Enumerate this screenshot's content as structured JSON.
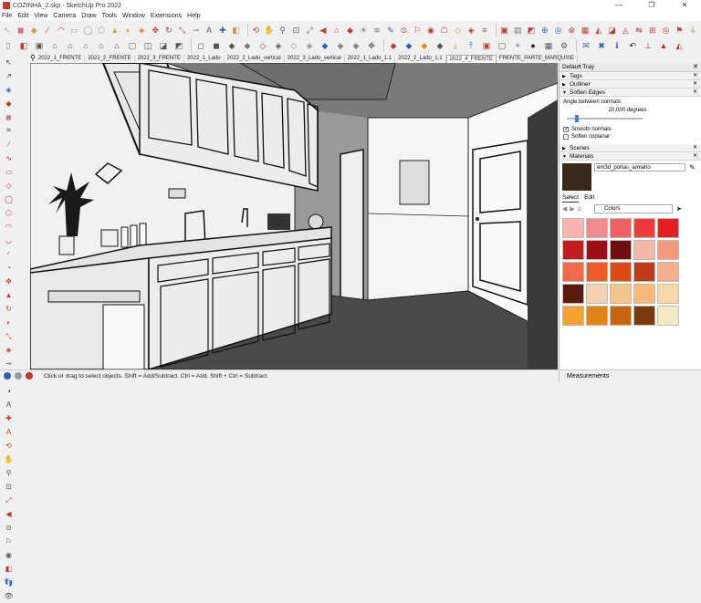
{
  "window": {
    "title": "COZINHA_2.skp - SketchUp Pro 2022",
    "buttons": [
      "—",
      "❐",
      "✕"
    ]
  },
  "menu": [
    "File",
    "Edit",
    "View",
    "Camera",
    "Draw",
    "Tools",
    "Window",
    "Extensions",
    "Help"
  ],
  "toolbar1": [
    {
      "icon": "select-icon",
      "glyph": "↖",
      "color": "#c7a45a"
    },
    {
      "icon": "eraser-icon",
      "glyph": "◼",
      "color": "#d56a8e"
    },
    {
      "icon": "paint-icon",
      "glyph": "◆",
      "color": "#d1a43a"
    },
    {
      "icon": "line-icon",
      "glyph": "∕",
      "color": "#c0392b"
    },
    {
      "icon": "arc-icon",
      "glyph": "◠",
      "color": "#c0392b"
    },
    {
      "icon": "rect-icon",
      "glyph": "▭",
      "color": "#999"
    },
    {
      "icon": "circle-icon",
      "glyph": "◯",
      "color": "#999"
    },
    {
      "icon": "polygon-icon",
      "glyph": "⬡",
      "color": "#999"
    },
    {
      "icon": "pushpull-icon",
      "glyph": "▲",
      "color": "#d1a43a"
    },
    {
      "icon": "follow-me-icon",
      "glyph": "◐",
      "color": "#d88f2a"
    },
    {
      "icon": "offset-icon",
      "glyph": "◈",
      "color": "#d18a3a"
    },
    {
      "icon": "move-icon",
      "glyph": "✥",
      "color": "#c0392b"
    },
    {
      "icon": "rotate-icon",
      "glyph": "↻",
      "color": "#c0392b"
    },
    {
      "icon": "scale-icon",
      "glyph": "⤡",
      "color": "#c0392b"
    },
    {
      "icon": "tape-icon",
      "glyph": "⊸",
      "color": "#777"
    },
    {
      "icon": "text-icon",
      "glyph": "A",
      "color": "#555"
    },
    {
      "icon": "axes-icon",
      "glyph": "✚",
      "color": "#2b5fb8"
    },
    {
      "icon": "section-icon",
      "glyph": "◧",
      "color": "#d18a3a"
    },
    {
      "icon": "orbit-icon",
      "glyph": "⟲",
      "color": "#c0392b"
    },
    {
      "icon": "pan-icon",
      "glyph": "✋",
      "color": "#777"
    },
    {
      "icon": "zoom-icon",
      "glyph": "⚲",
      "color": "#555"
    },
    {
      "icon": "zoom-window-icon",
      "glyph": "⊡",
      "color": "#555"
    },
    {
      "icon": "zoom-extents-icon",
      "glyph": "⤢",
      "color": "#555"
    },
    {
      "icon": "prev-view-icon",
      "glyph": "◀",
      "color": "#c0392b"
    },
    {
      "icon": "warehouse-icon",
      "glyph": "⌂",
      "color": "#c0392b"
    },
    {
      "icon": "extension-icon",
      "glyph": "◆",
      "color": "#c0392b"
    },
    {
      "icon": "shadows-icon",
      "glyph": "☀",
      "color": "#777"
    },
    {
      "icon": "fog-icon",
      "glyph": "≋",
      "color": "#777"
    },
    {
      "icon": "edit-icon",
      "glyph": "✎",
      "color": "#2b5fb8"
    },
    {
      "icon": "camera-icon",
      "glyph": "⊙",
      "color": "#c0392b"
    },
    {
      "icon": "walk-icon",
      "glyph": "⚐",
      "color": "#c0392b"
    },
    {
      "icon": "look-around-icon",
      "glyph": "◉",
      "color": "#c0392b"
    },
    {
      "icon": "position-camera-icon",
      "glyph": "☖",
      "color": "#c0392b"
    },
    {
      "icon": "component-icon",
      "glyph": "◇",
      "color": "#d88f2a"
    },
    {
      "icon": "material-icon",
      "glyph": "◈",
      "color": "#c0392b"
    },
    {
      "icon": "outliner-icon",
      "glyph": "≡",
      "color": "#c0392b"
    },
    {
      "icon": "scene-icon",
      "glyph": "▣",
      "color": "#c0392b"
    },
    {
      "icon": "layers-icon",
      "glyph": "▤",
      "color": "#777"
    },
    {
      "icon": "styles-icon",
      "glyph": "◩",
      "color": "#c0392b"
    },
    {
      "icon": "geo-icon",
      "glyph": "⊕",
      "color": "#2b5fb8"
    },
    {
      "icon": "add-location-icon",
      "glyph": "◎",
      "color": "#2b5fb8"
    },
    {
      "icon": "trimble-icon",
      "glyph": "⊗",
      "color": "#c0392b"
    },
    {
      "icon": "sandbox-icon",
      "glyph": "▦",
      "color": "#c0392b"
    },
    {
      "icon": "smoove-icon",
      "glyph": "◭",
      "color": "#c0392b"
    },
    {
      "icon": "stamp-icon",
      "glyph": "◪",
      "color": "#c0392b"
    },
    {
      "icon": "drape-icon",
      "glyph": "◬",
      "color": "#c0392b"
    },
    {
      "icon": "flip-icon",
      "glyph": "⇋",
      "color": "#c0392b"
    },
    {
      "icon": "scene-plus-icon",
      "glyph": "⊞",
      "color": "#c0392b"
    },
    {
      "icon": "target-icon",
      "glyph": "◎",
      "color": "#c0392b"
    },
    {
      "icon": "pin-icon",
      "glyph": "⚑",
      "color": "#c0392b"
    },
    {
      "icon": "pipe-icon",
      "glyph": "⏚",
      "color": "#d18a3a"
    }
  ],
  "toolbar2": [
    {
      "icon": "new-icon",
      "glyph": "▯",
      "color": "#777"
    },
    {
      "icon": "open-icon",
      "glyph": "◧",
      "color": "#c0392b"
    },
    {
      "icon": "save-icon",
      "glyph": "▣",
      "color": "#555"
    },
    {
      "icon": "home-icon",
      "glyph": "⌂",
      "color": "#555"
    },
    {
      "icon": "front-view-icon",
      "glyph": "⌂",
      "color": "#555"
    },
    {
      "icon": "right-view-icon",
      "glyph": "⌂",
      "color": "#555"
    },
    {
      "icon": "back-view-icon",
      "glyph": "⌂",
      "color": "#555"
    },
    {
      "icon": "left-view-icon",
      "glyph": "⌂",
      "color": "#555"
    },
    {
      "icon": "top-view-icon",
      "glyph": "▢",
      "color": "#555"
    },
    {
      "icon": "iso-view-icon",
      "glyph": "◫",
      "color": "#555"
    },
    {
      "icon": "xray-icon",
      "glyph": "◪",
      "color": "#555"
    },
    {
      "icon": "back-edges-icon",
      "glyph": "◩",
      "color": "#555"
    },
    {
      "icon": "wireframe-icon",
      "glyph": "◻",
      "color": "#555"
    },
    {
      "icon": "hidden-line-icon",
      "glyph": "◼",
      "color": "#555"
    },
    {
      "icon": "shaded-icon",
      "glyph": "◆",
      "color": "#555"
    },
    {
      "icon": "shaded-tex-icon",
      "glyph": "◆",
      "color": "#777"
    },
    {
      "icon": "monochrome-icon",
      "glyph": "◇",
      "color": "#555"
    },
    {
      "icon": "style-a-icon",
      "glyph": "◈",
      "color": "#555"
    },
    {
      "icon": "style-b-icon",
      "glyph": "◇",
      "color": "#888"
    },
    {
      "icon": "style-c-icon",
      "glyph": "◈",
      "color": "#888"
    },
    {
      "icon": "style-d-icon",
      "glyph": "◆",
      "color": "#2b5fb8"
    },
    {
      "icon": "style-e-icon",
      "glyph": "◆",
      "color": "#888"
    },
    {
      "icon": "style-f-icon",
      "glyph": "◆",
      "color": "#888"
    },
    {
      "icon": "move-tool-icon",
      "glyph": "✥",
      "color": "#555"
    },
    {
      "icon": "color-cube-icon",
      "glyph": "◆",
      "color": "#c0392b"
    },
    {
      "icon": "color-cube2-icon",
      "glyph": "◆",
      "color": "#2b5fb8"
    },
    {
      "icon": "color-cube3-icon",
      "glyph": "◆",
      "color": "#d88f2a"
    },
    {
      "icon": "color-cube4-icon",
      "glyph": "◆",
      "color": "#555"
    },
    {
      "icon": "import-icon",
      "glyph": "⤓",
      "color": "#d18a3a"
    },
    {
      "icon": "export-icon",
      "glyph": "⤒",
      "color": "#2b5fb8"
    },
    {
      "icon": "cube-icon",
      "glyph": "▣",
      "color": "#c0392b"
    },
    {
      "icon": "group-icon",
      "glyph": "▢",
      "color": "#555"
    },
    {
      "icon": "add-icon",
      "glyph": "+",
      "color": "#2b5fb8"
    },
    {
      "icon": "solid-icon",
      "glyph": "●",
      "color": "#111"
    },
    {
      "icon": "checker-icon",
      "glyph": "▦",
      "color": "#555"
    },
    {
      "icon": "network-icon",
      "glyph": "⚙",
      "color": "#555"
    },
    {
      "icon": "mail-icon",
      "glyph": "✉",
      "color": "#2b5fb8"
    },
    {
      "icon": "close-x-icon",
      "glyph": "✖",
      "color": "#2b5fb8"
    },
    {
      "icon": "info-icon",
      "glyph": "ℹ",
      "color": "#2b5fb8"
    },
    {
      "icon": "undo-icon",
      "glyph": "↶",
      "color": "#111"
    },
    {
      "icon": "dimension-icon",
      "glyph": "⊥",
      "color": "#555"
    },
    {
      "icon": "warning-icon",
      "glyph": "▲",
      "color": "#c0392b"
    },
    {
      "icon": "paint-bucket-icon",
      "glyph": "◭",
      "color": "#c0392b"
    }
  ],
  "left_tools": [
    {
      "icon": "select-arrow-icon",
      "glyph": "↖",
      "color": "#333"
    },
    {
      "icon": "lasso-icon",
      "glyph": "↗",
      "color": "#333"
    },
    {
      "icon": "make-component-icon",
      "glyph": "◈",
      "color": "#2b5fb8"
    },
    {
      "icon": "paint-bucket-icon",
      "glyph": "◆",
      "color": "#c0392b"
    },
    {
      "icon": "eraser-icon",
      "glyph": "◼",
      "color": "#c07f8e"
    },
    {
      "icon": "tag-icon",
      "glyph": "⚑",
      "color": "#999"
    },
    {
      "icon": "line-tool-icon",
      "glyph": "∕",
      "color": "#c0392b"
    },
    {
      "icon": "freehand-icon",
      "glyph": "∿",
      "color": "#c0392b"
    },
    {
      "icon": "rectangle-icon",
      "glyph": "▭",
      "color": "#c0392b"
    },
    {
      "icon": "rot-rect-icon",
      "glyph": "◇",
      "color": "#c0392b"
    },
    {
      "icon": "circle-tool-icon",
      "glyph": "◯",
      "color": "#c0392b"
    },
    {
      "icon": "polygon-tool-icon",
      "glyph": "⬡",
      "color": "#c0392b"
    },
    {
      "icon": "arc-tool-icon",
      "glyph": "◠",
      "color": "#c0392b"
    },
    {
      "icon": "arc2-icon",
      "glyph": "◡",
      "color": "#c0392b"
    },
    {
      "icon": "arc3-icon",
      "glyph": "◜",
      "color": "#c0392b"
    },
    {
      "icon": "pie-icon",
      "glyph": "◔",
      "color": "#c0392b"
    },
    {
      "icon": "move-tool-icon",
      "glyph": "✥",
      "color": "#c0392b"
    },
    {
      "icon": "pushpull-tool-icon",
      "glyph": "▲",
      "color": "#c0392b"
    },
    {
      "icon": "rotate-tool-icon",
      "glyph": "↻",
      "color": "#c0392b"
    },
    {
      "icon": "follow-tool-icon",
      "glyph": "◐",
      "color": "#c0392b"
    },
    {
      "icon": "scale-tool-icon",
      "glyph": "⤡",
      "color": "#c0392b"
    },
    {
      "icon": "offset-tool-icon",
      "glyph": "◈",
      "color": "#c0392b"
    },
    {
      "icon": "tape-tool-icon",
      "glyph": "⊸",
      "color": "#555"
    },
    {
      "icon": "dimension-tool-icon",
      "glyph": "⟷",
      "color": "#555"
    },
    {
      "icon": "protractor-icon",
      "glyph": "◑",
      "color": "#555"
    },
    {
      "icon": "text-tool-icon",
      "glyph": "A",
      "color": "#555"
    },
    {
      "icon": "axes-tool-icon",
      "glyph": "✚",
      "color": "#c0392b"
    },
    {
      "icon": "3dtext-icon",
      "glyph": "A",
      "color": "#c0392b"
    },
    {
      "icon": "orbit-tool-icon",
      "glyph": "⟲",
      "color": "#c0392b"
    },
    {
      "icon": "pan-tool-icon",
      "glyph": "✋",
      "color": "#555"
    },
    {
      "icon": "zoom-tool-icon",
      "glyph": "⚲",
      "color": "#555"
    },
    {
      "icon": "zoom-win-tool-icon",
      "glyph": "⊡",
      "color": "#555"
    },
    {
      "icon": "zoom-ext-tool-icon",
      "glyph": "⤢",
      "color": "#c0392b"
    },
    {
      "icon": "prev-tool-icon",
      "glyph": "◀",
      "color": "#c0392b"
    },
    {
      "icon": "camera-tool-icon",
      "glyph": "⊙",
      "color": "#555"
    },
    {
      "icon": "walk-tool-icon",
      "glyph": "⚐",
      "color": "#555"
    },
    {
      "icon": "look-tool-icon",
      "glyph": "◉",
      "color": "#555"
    },
    {
      "icon": "section-tool-icon",
      "glyph": "◧",
      "color": "#c0392b"
    },
    {
      "icon": "footprint-icon",
      "glyph": "👣",
      "color": "#555"
    },
    {
      "icon": "eye-icon",
      "glyph": "👁",
      "color": "#555"
    }
  ],
  "scene_tabs": [
    "2022_1_FRENTE",
    "2022_2_FRENTE",
    "2022_3_FRENTE",
    "2022_1_Lado",
    "2022_2_Lado_vertical",
    "2022_3_Lado_vertical",
    "2022_1_Lado_1.1",
    "2022_2_Lado_1.1",
    "2022_4_FRENTE",
    "FRENTE_PARTE_MARQUISE"
  ],
  "active_tab_index": 8,
  "tray": {
    "title": "Default Tray",
    "panels": {
      "tags": "Tags",
      "outliner": "Outliner",
      "soften": "Soften Edges",
      "scenes": "Scenes",
      "materials": "Materials"
    },
    "soften": {
      "angle_label": "Angle between normals:",
      "angle_value": "20,000  degrees",
      "slider_fraction": 0.11,
      "smooth_label": "Smooth normals",
      "smooth_checked": true,
      "coplanar_label": "Soften coplanar",
      "coplanar_checked": false
    },
    "materials": {
      "name": "em3d_portas_armario",
      "tab_select": "Select",
      "tab_edit": "Edit",
      "library": "Colors",
      "swatches": [
        "#f7b5ae",
        "#f28a8c",
        "#f06065",
        "#ef3a3e",
        "#e81e25",
        "#c31c1f",
        "#9b1016",
        "#6f0c10",
        "#f4b8a6",
        "#f19a80",
        "#f36a4a",
        "#ef5a2b",
        "#dd4a1a",
        "#c0391b",
        "#f3b08a",
        "#5a1b0f",
        "#f6cfae",
        "#f3c48a",
        "#f6b978",
        "#f7d7a6",
        "#f2a330",
        "#e0811a",
        "#c9650f",
        "#7a3a0c",
        "#f5e7c0"
      ]
    }
  },
  "status": {
    "message": "Click or drag to select objects. Shift = Add/Subtract. Ctrl = Add. Shift + Ctrl = Subtract.",
    "measurements_label": "Measurements"
  }
}
